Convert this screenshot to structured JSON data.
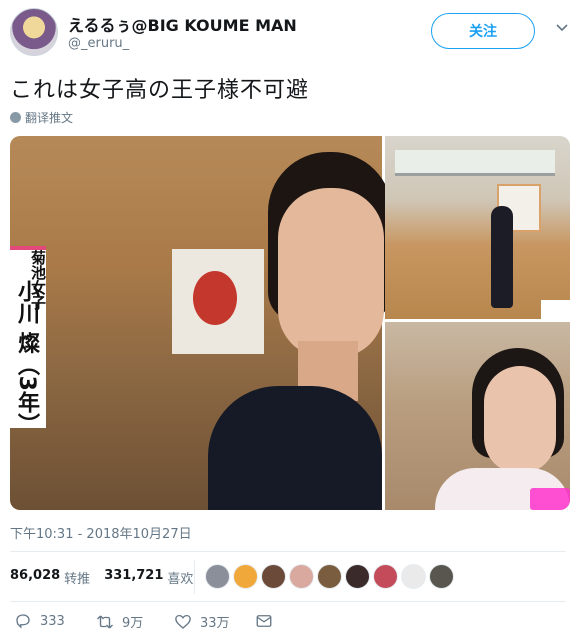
{
  "header": {
    "display_name": "えるるぅ@BIG KOUME MAN",
    "handle": "@_eruru_",
    "follow_label": "关注"
  },
  "tweet": {
    "text": "これは女子高の王子様不可避",
    "translate_label": "翻译推文",
    "timestamp": "下午10:31 - 2018年10月27日"
  },
  "media": {
    "caption_school": "菊池女子",
    "caption_name": "小川 燦（3年）"
  },
  "stats": {
    "retweets_count": "86,028",
    "retweets_label": "转推",
    "likes_count": "331,721",
    "likes_label": "喜欢"
  },
  "liker_avatars": [
    "#8a8f99",
    "#f0a83a",
    "#6c4a3a",
    "#d9a9a0",
    "#7a5c3e",
    "#3a2a2a",
    "#c44b5a",
    "#eaeaea",
    "#58564f"
  ],
  "actions": {
    "replies": "333",
    "retweets": "9万",
    "likes": "33万"
  },
  "colors": {
    "accent": "#1da1f2",
    "secondary_text": "#657786"
  }
}
